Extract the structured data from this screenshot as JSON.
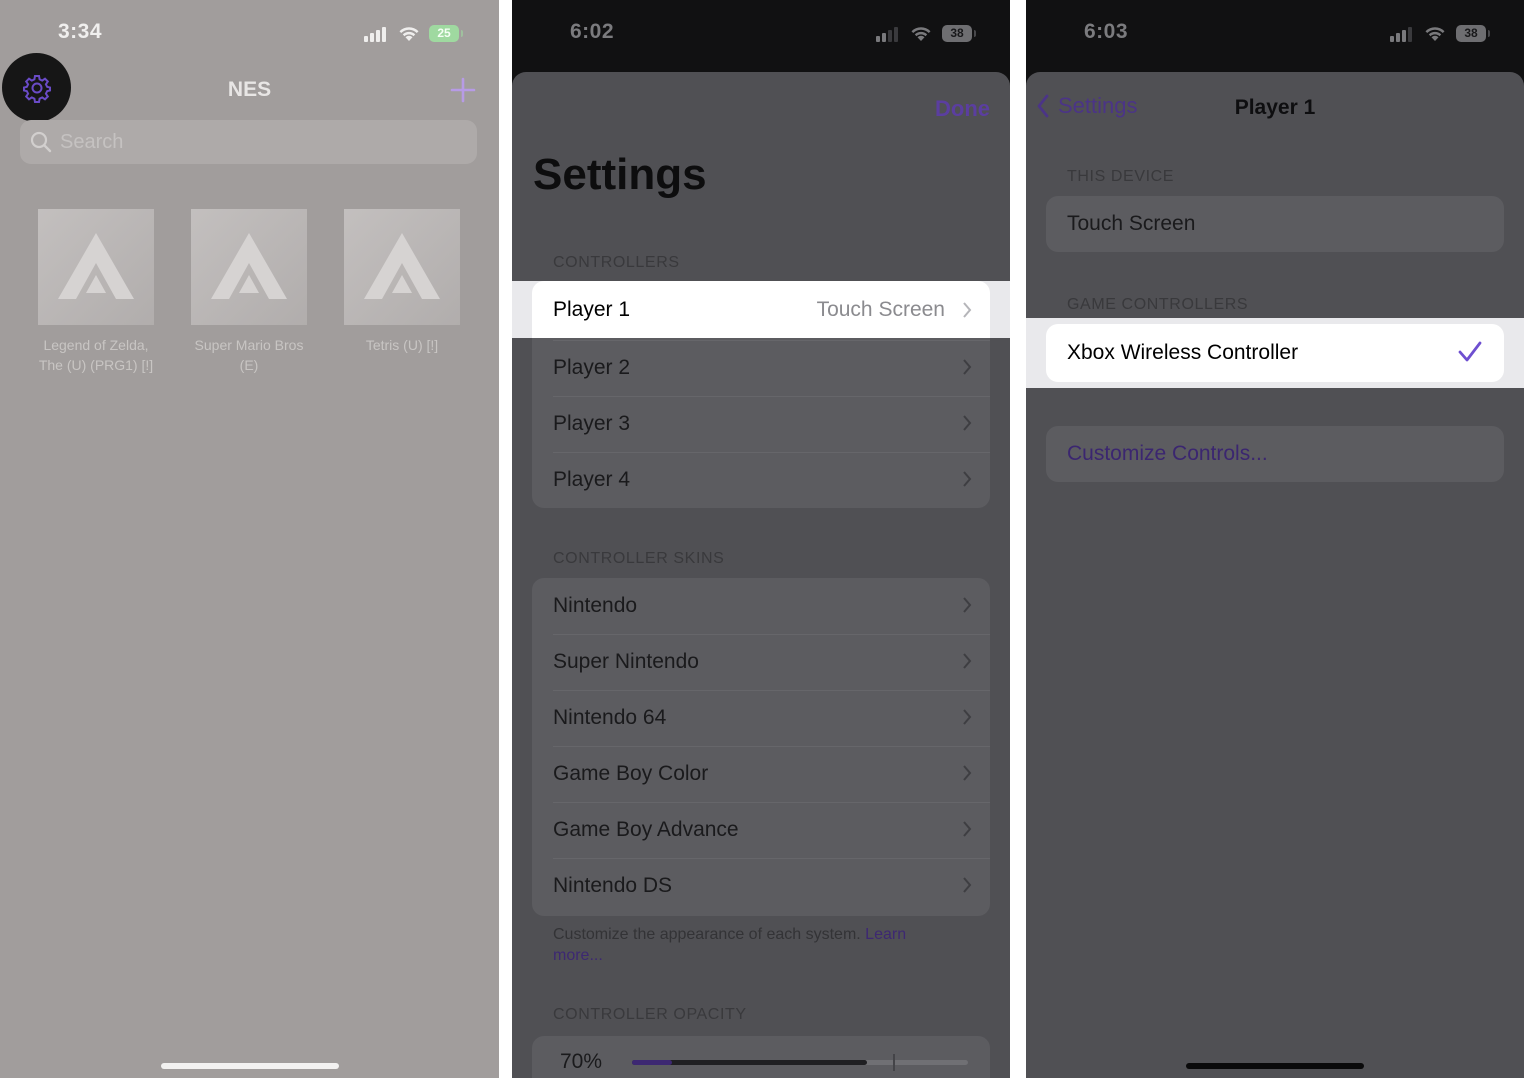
{
  "colors": {
    "accent": "#6e4fd0",
    "highlight_bg": "#ffffff",
    "dimmed_bg": "#505054"
  },
  "panel1": {
    "status": {
      "time": "3:34",
      "battery": "25"
    },
    "title": "NES",
    "search_placeholder": "Search",
    "icons": [
      "gear-icon",
      "plus-icon",
      "search-icon"
    ],
    "games": [
      {
        "name": "Legend of Zelda, The (U) (PRG1) [!]"
      },
      {
        "name": "Super Mario Bros (E)"
      },
      {
        "name": "Tetris (U) [!]"
      }
    ]
  },
  "panel2": {
    "status": {
      "time": "6:02",
      "battery": "38"
    },
    "done_label": "Done",
    "title": "Settings",
    "controllers_header": "CONTROLLERS",
    "players": [
      {
        "label": "Player 1",
        "value": "Touch Screen"
      },
      {
        "label": "Player 2",
        "value": ""
      },
      {
        "label": "Player 3",
        "value": ""
      },
      {
        "label": "Player 4",
        "value": ""
      }
    ],
    "skins_header": "CONTROLLER SKINS",
    "skins": [
      {
        "label": "Nintendo"
      },
      {
        "label": "Super Nintendo"
      },
      {
        "label": "Nintendo 64"
      },
      {
        "label": "Game Boy Color"
      },
      {
        "label": "Game Boy Advance"
      },
      {
        "label": "Nintendo DS"
      }
    ],
    "skins_footer": "Customize the appearance of each system.",
    "skins_footer_link_1": "Learn",
    "skins_footer_link_2": "more...",
    "opacity_header": "CONTROLLER OPACITY",
    "opacity_value": "70%",
    "opacity_level": 0.7
  },
  "panel3": {
    "status": {
      "time": "6:03",
      "battery": "38"
    },
    "back_label": "Settings",
    "title": "Player 1",
    "device_header": "THIS DEVICE",
    "device_item": "Touch Screen",
    "gc_header": "GAME CONTROLLERS",
    "gc_item": "Xbox Wireless Controller",
    "gc_selected": true,
    "customize_label": "Customize Controls..."
  }
}
